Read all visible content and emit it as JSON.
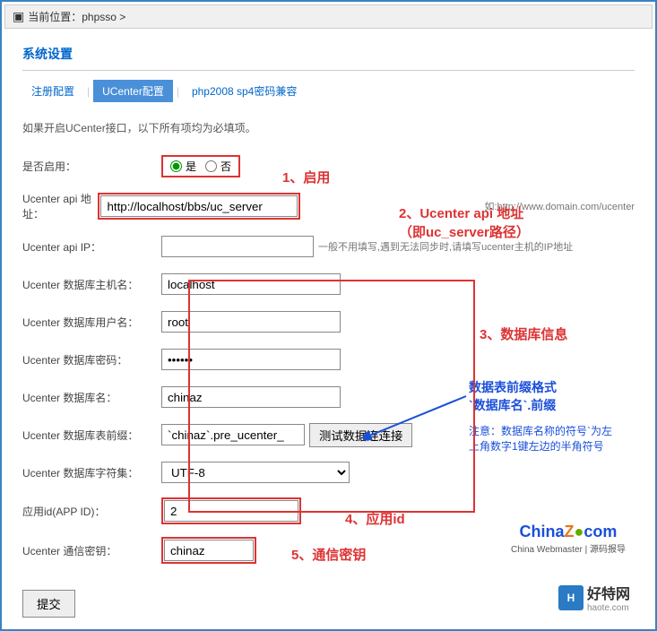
{
  "breadcrumb": {
    "label": "当前位置：",
    "path": "phpsso >",
    "icon": "▣"
  },
  "page_title": "系统设置",
  "tabs": {
    "t1": "注册配置",
    "t2": "UCenter配置",
    "t3": "php2008 sp4密码兼容"
  },
  "help_text": "如果开启UCenter接口，以下所有项均为必填项。",
  "form": {
    "enable_label": "是否启用：",
    "radio_yes": "是",
    "radio_no": "否",
    "api_addr_label": "Ucenter api 地址：",
    "api_addr_value": "http://localhost/bbs/uc_server",
    "api_addr_hint": "如:http://www.domain.com/ucenter",
    "api_ip_label": "Ucenter api IP：",
    "api_ip_value": "",
    "api_ip_hint": "一般不用填写,遇到无法同步时,请填写ucenter主机的IP地址",
    "db_host_label": "Ucenter 数据库主机名：",
    "db_host_value": "localhost",
    "db_user_label": "Ucenter 数据库用户名：",
    "db_user_value": "root",
    "db_pass_label": "Ucenter 数据库密码：",
    "db_pass_value": "••••••",
    "db_name_label": "Ucenter 数据库名：",
    "db_name_value": "chinaz",
    "db_prefix_label": "Ucenter 数据库表前缀：",
    "db_prefix_value": "`chinaz`.pre_ucenter_",
    "test_btn": "测试数据连连接",
    "db_charset_label": "Ucenter 数据库字符集：",
    "db_charset_value": "UTF-8",
    "app_id_label": "应用id(APP ID)：",
    "app_id_value": "2",
    "comm_key_label": "Ucenter 通信密钥：",
    "comm_key_value": "chinaz",
    "submit": "提交"
  },
  "annotations": {
    "a1": "1、启用",
    "a2": "2、Ucenter api 地址\n（即uc_server路径）",
    "a3": "3、数据库信息",
    "a4_title": "数据表前缀格式\n`数据库名`.前缀",
    "a4_note": "注意：数据库名称的符号`为左上角数字1键左边的半角符号",
    "a5": "4、应用id",
    "a6": "5、通信密钥"
  },
  "logo": {
    "chinaz": "ChinaZ.com",
    "sub": "China Webmaster | 源码报导"
  },
  "haote": {
    "cn": "好特网",
    "en": "haote.com",
    "icon": "H"
  }
}
